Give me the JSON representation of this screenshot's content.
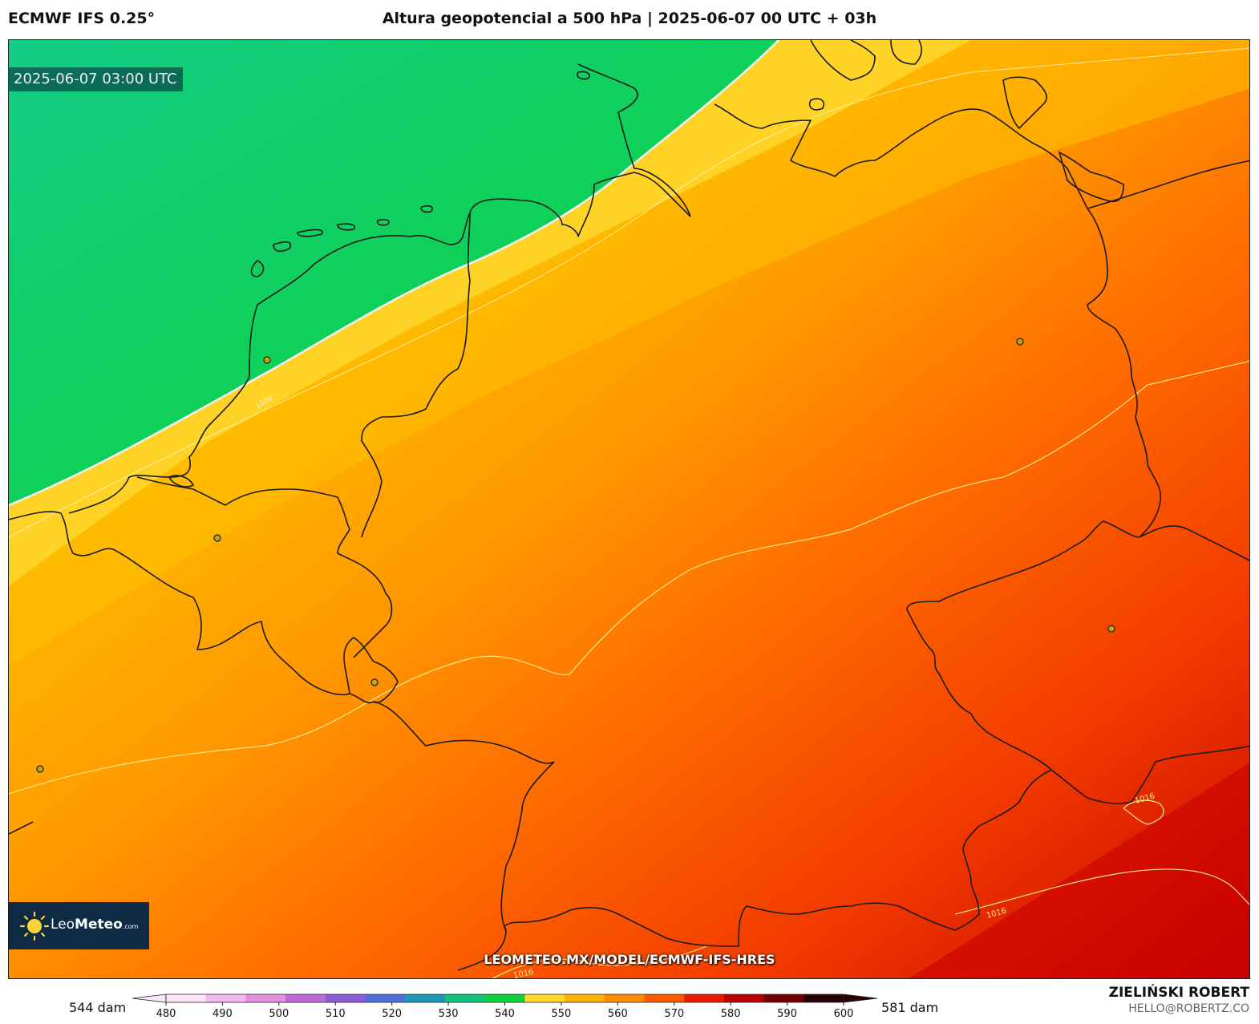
{
  "header": {
    "model": "ECMWF IFS 0.25°",
    "title": "Altura geopotencial a 500 hPa | 2025-06-07 00 UTC + 03h"
  },
  "map": {
    "timestamp": "2025-06-07 03:00 UTC",
    "watermark": "LEOMETEO.MX/MODEL/ECMWF-IFS-HRES",
    "isobar_label": "1016",
    "isobar_label_north": "1008",
    "colors": {
      "green_deep": "#0bd23f",
      "green_teal": "#14cc86",
      "yellow": "#ffd62a",
      "orange": "#ff9a00",
      "red": "#e01a00",
      "dark_red": "#c40000"
    }
  },
  "logo": {
    "text_light": "Leo",
    "text_bold": "Meteo",
    "text_small": ".com",
    "icon": "sun-icon"
  },
  "colorbar": {
    "min_label": "544 dam",
    "max_label": "581 dam",
    "ticks": [
      "480",
      "490",
      "500",
      "510",
      "520",
      "530",
      "540",
      "550",
      "560",
      "570",
      "580",
      "590",
      "600"
    ],
    "colors": [
      "#fbe4f7",
      "#f3b9ec",
      "#e58ee0",
      "#c06ad8",
      "#8a5cd8",
      "#4d6fd8",
      "#1f98b8",
      "#12c47a",
      "#0bd23f",
      "#ffd62a",
      "#ffb300",
      "#ff8c00",
      "#ff5a00",
      "#e81a00",
      "#b80000",
      "#700000",
      "#2a0000"
    ]
  },
  "author": {
    "name": "ZIELIŃSKI ROBERT",
    "email": "HELLO@ROBERTZ.CO"
  }
}
